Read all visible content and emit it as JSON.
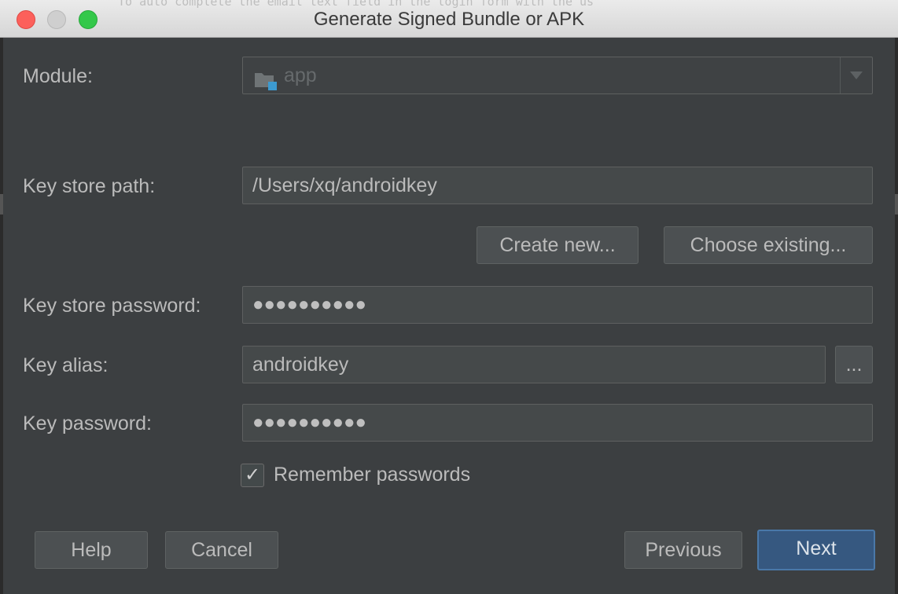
{
  "window": {
    "title": "Generate Signed Bundle or APK",
    "background_text": "To auto complete the email text field in the login form with the us"
  },
  "module": {
    "label": "Module:",
    "value": "app"
  },
  "keystore": {
    "path_label": "Key store path:",
    "path_value": "/Users/xq/androidkey",
    "create_new_label": "Create new...",
    "choose_existing_label": "Choose existing...",
    "password_label": "Key store password:",
    "password_masked": "●●●●●●●●●●"
  },
  "key": {
    "alias_label": "Key alias:",
    "alias_value": "androidkey",
    "browse_label": "...",
    "password_label": "Key password:",
    "password_masked": "●●●●●●●●●●"
  },
  "remember": {
    "label": "Remember passwords",
    "checked": true,
    "check_glyph": "✓"
  },
  "footer": {
    "help_label": "Help",
    "cancel_label": "Cancel",
    "previous_label": "Previous",
    "next_label": "Next"
  },
  "colors": {
    "dialog_bg": "#3c3f41",
    "field_bg": "#45494a",
    "primary_button": "#365880",
    "text": "#bbbbbb"
  }
}
